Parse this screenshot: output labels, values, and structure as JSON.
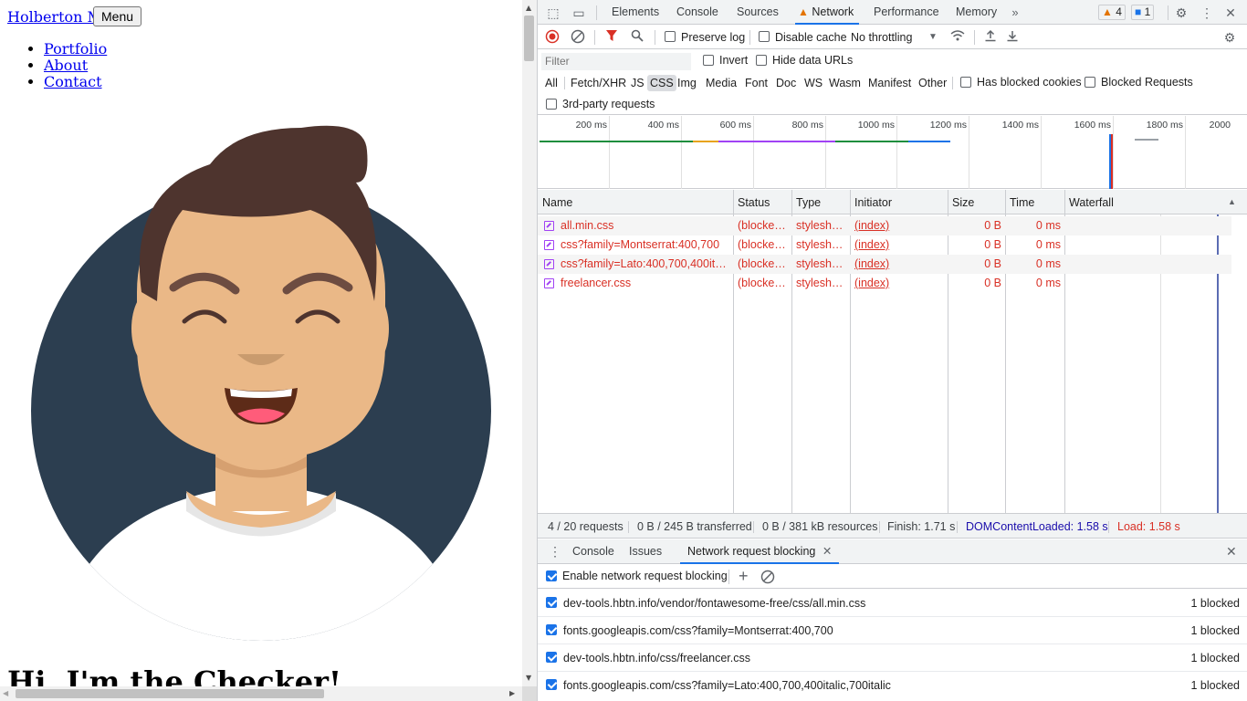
{
  "page": {
    "brand": "Holberton Me",
    "menu_button": "Menu",
    "nav": [
      "Portfolio",
      "About",
      "Contact"
    ],
    "hero_heading": "Hi, I'm the Checker!"
  },
  "devtools": {
    "tabs": [
      "Elements",
      "Console",
      "Sources",
      "Network",
      "Performance",
      "Memory"
    ],
    "active_tab": "Network",
    "more_tabs_icon": "chevron-double-right",
    "warnings_count": "4",
    "messages_count": "1",
    "toolbar": {
      "preserve_log": "Preserve log",
      "disable_cache": "Disable cache",
      "throttling": "No throttling"
    },
    "filter": {
      "placeholder": "Filter",
      "invert": "Invert",
      "hide_data_urls": "Hide data URLs"
    },
    "type_filters": [
      "All",
      "Fetch/XHR",
      "JS",
      "CSS",
      "Img",
      "Media",
      "Font",
      "Doc",
      "WS",
      "Wasm",
      "Manifest",
      "Other"
    ],
    "active_type": "CSS",
    "has_blocked_cookies": "Has blocked cookies",
    "blocked_requests": "Blocked Requests",
    "third_party": "3rd-party requests",
    "timeline_ticks": [
      "200 ms",
      "400 ms",
      "600 ms",
      "800 ms",
      "1000 ms",
      "1200 ms",
      "1400 ms",
      "1600 ms",
      "1800 ms",
      "2000"
    ],
    "columns": [
      "Name",
      "Status",
      "Type",
      "Initiator",
      "Size",
      "Time",
      "Waterfall"
    ],
    "requests": [
      {
        "name": "all.min.css",
        "status": "(blocked...",
        "type": "stylesheet",
        "initiator": "(index)",
        "size": "0 B",
        "time": "0 ms"
      },
      {
        "name": "css?family=Montserrat:400,700",
        "status": "(blocked...",
        "type": "stylesheet",
        "initiator": "(index)",
        "size": "0 B",
        "time": "0 ms"
      },
      {
        "name": "css?family=Lato:400,700,400italic...",
        "status": "(blocked...",
        "type": "stylesheet",
        "initiator": "(index)",
        "size": "0 B",
        "time": "0 ms"
      },
      {
        "name": "freelancer.css",
        "status": "(blocked...",
        "type": "stylesheet",
        "initiator": "(index)",
        "size": "0 B",
        "time": "0 ms"
      }
    ],
    "status_bar": {
      "requests": "4 / 20 requests",
      "transferred": "0 B / 245 B transferred",
      "resources": "0 B / 381 kB resources",
      "finish": "Finish: 1.71 s",
      "dom_loaded": "DOMContentLoaded: 1.58 s",
      "load": "Load: 1.58 s"
    },
    "drawer": {
      "tabs": [
        "Console",
        "Issues",
        "Network request blocking"
      ],
      "active_tab": "Network request blocking",
      "enable_label": "Enable network request blocking",
      "patterns": [
        {
          "url": "dev-tools.hbtn.info/vendor/fontawesome-free/css/all.min.css",
          "count": "1 blocked"
        },
        {
          "url": "fonts.googleapis.com/css?family=Montserrat:400,700",
          "count": "1 blocked"
        },
        {
          "url": "dev-tools.hbtn.info/css/freelancer.css",
          "count": "1 blocked"
        },
        {
          "url": "fonts.googleapis.com/css?family=Lato:400,700,400italic,700italic",
          "count": "1 blocked"
        }
      ]
    },
    "colors": {
      "accent": "#1a73e8",
      "error_red": "#d93025",
      "css_purple": "#a142f4"
    }
  }
}
